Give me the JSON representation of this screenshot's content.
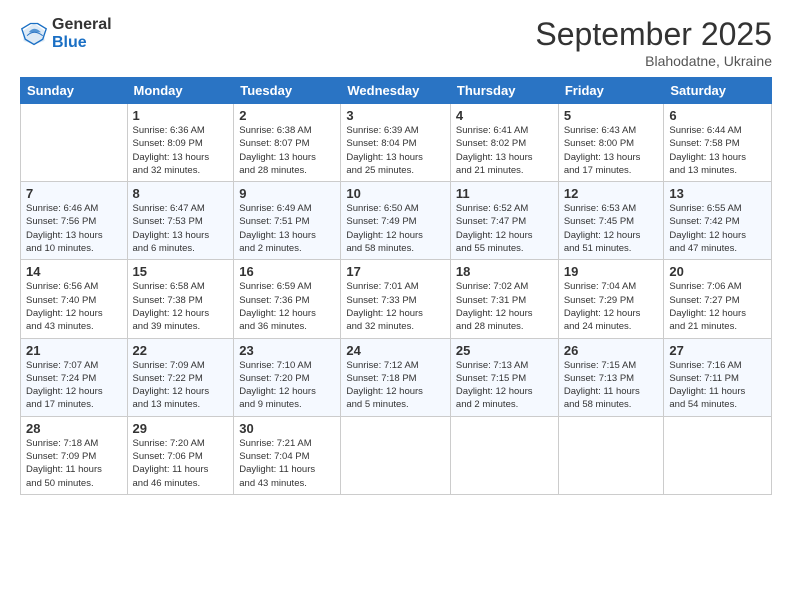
{
  "logo": {
    "general": "General",
    "blue": "Blue"
  },
  "title": "September 2025",
  "location": "Blahodatne, Ukraine",
  "days_of_week": [
    "Sunday",
    "Monday",
    "Tuesday",
    "Wednesday",
    "Thursday",
    "Friday",
    "Saturday"
  ],
  "weeks": [
    [
      {
        "day": "",
        "info": ""
      },
      {
        "day": "1",
        "info": "Sunrise: 6:36 AM\nSunset: 8:09 PM\nDaylight: 13 hours\nand 32 minutes."
      },
      {
        "day": "2",
        "info": "Sunrise: 6:38 AM\nSunset: 8:07 PM\nDaylight: 13 hours\nand 28 minutes."
      },
      {
        "day": "3",
        "info": "Sunrise: 6:39 AM\nSunset: 8:04 PM\nDaylight: 13 hours\nand 25 minutes."
      },
      {
        "day": "4",
        "info": "Sunrise: 6:41 AM\nSunset: 8:02 PM\nDaylight: 13 hours\nand 21 minutes."
      },
      {
        "day": "5",
        "info": "Sunrise: 6:43 AM\nSunset: 8:00 PM\nDaylight: 13 hours\nand 17 minutes."
      },
      {
        "day": "6",
        "info": "Sunrise: 6:44 AM\nSunset: 7:58 PM\nDaylight: 13 hours\nand 13 minutes."
      }
    ],
    [
      {
        "day": "7",
        "info": "Sunrise: 6:46 AM\nSunset: 7:56 PM\nDaylight: 13 hours\nand 10 minutes."
      },
      {
        "day": "8",
        "info": "Sunrise: 6:47 AM\nSunset: 7:53 PM\nDaylight: 13 hours\nand 6 minutes."
      },
      {
        "day": "9",
        "info": "Sunrise: 6:49 AM\nSunset: 7:51 PM\nDaylight: 13 hours\nand 2 minutes."
      },
      {
        "day": "10",
        "info": "Sunrise: 6:50 AM\nSunset: 7:49 PM\nDaylight: 12 hours\nand 58 minutes."
      },
      {
        "day": "11",
        "info": "Sunrise: 6:52 AM\nSunset: 7:47 PM\nDaylight: 12 hours\nand 55 minutes."
      },
      {
        "day": "12",
        "info": "Sunrise: 6:53 AM\nSunset: 7:45 PM\nDaylight: 12 hours\nand 51 minutes."
      },
      {
        "day": "13",
        "info": "Sunrise: 6:55 AM\nSunset: 7:42 PM\nDaylight: 12 hours\nand 47 minutes."
      }
    ],
    [
      {
        "day": "14",
        "info": "Sunrise: 6:56 AM\nSunset: 7:40 PM\nDaylight: 12 hours\nand 43 minutes."
      },
      {
        "day": "15",
        "info": "Sunrise: 6:58 AM\nSunset: 7:38 PM\nDaylight: 12 hours\nand 39 minutes."
      },
      {
        "day": "16",
        "info": "Sunrise: 6:59 AM\nSunset: 7:36 PM\nDaylight: 12 hours\nand 36 minutes."
      },
      {
        "day": "17",
        "info": "Sunrise: 7:01 AM\nSunset: 7:33 PM\nDaylight: 12 hours\nand 32 minutes."
      },
      {
        "day": "18",
        "info": "Sunrise: 7:02 AM\nSunset: 7:31 PM\nDaylight: 12 hours\nand 28 minutes."
      },
      {
        "day": "19",
        "info": "Sunrise: 7:04 AM\nSunset: 7:29 PM\nDaylight: 12 hours\nand 24 minutes."
      },
      {
        "day": "20",
        "info": "Sunrise: 7:06 AM\nSunset: 7:27 PM\nDaylight: 12 hours\nand 21 minutes."
      }
    ],
    [
      {
        "day": "21",
        "info": "Sunrise: 7:07 AM\nSunset: 7:24 PM\nDaylight: 12 hours\nand 17 minutes."
      },
      {
        "day": "22",
        "info": "Sunrise: 7:09 AM\nSunset: 7:22 PM\nDaylight: 12 hours\nand 13 minutes."
      },
      {
        "day": "23",
        "info": "Sunrise: 7:10 AM\nSunset: 7:20 PM\nDaylight: 12 hours\nand 9 minutes."
      },
      {
        "day": "24",
        "info": "Sunrise: 7:12 AM\nSunset: 7:18 PM\nDaylight: 12 hours\nand 5 minutes."
      },
      {
        "day": "25",
        "info": "Sunrise: 7:13 AM\nSunset: 7:15 PM\nDaylight: 12 hours\nand 2 minutes."
      },
      {
        "day": "26",
        "info": "Sunrise: 7:15 AM\nSunset: 7:13 PM\nDaylight: 11 hours\nand 58 minutes."
      },
      {
        "day": "27",
        "info": "Sunrise: 7:16 AM\nSunset: 7:11 PM\nDaylight: 11 hours\nand 54 minutes."
      }
    ],
    [
      {
        "day": "28",
        "info": "Sunrise: 7:18 AM\nSunset: 7:09 PM\nDaylight: 11 hours\nand 50 minutes."
      },
      {
        "day": "29",
        "info": "Sunrise: 7:20 AM\nSunset: 7:06 PM\nDaylight: 11 hours\nand 46 minutes."
      },
      {
        "day": "30",
        "info": "Sunrise: 7:21 AM\nSunset: 7:04 PM\nDaylight: 11 hours\nand 43 minutes."
      },
      {
        "day": "",
        "info": ""
      },
      {
        "day": "",
        "info": ""
      },
      {
        "day": "",
        "info": ""
      },
      {
        "day": "",
        "info": ""
      }
    ]
  ]
}
